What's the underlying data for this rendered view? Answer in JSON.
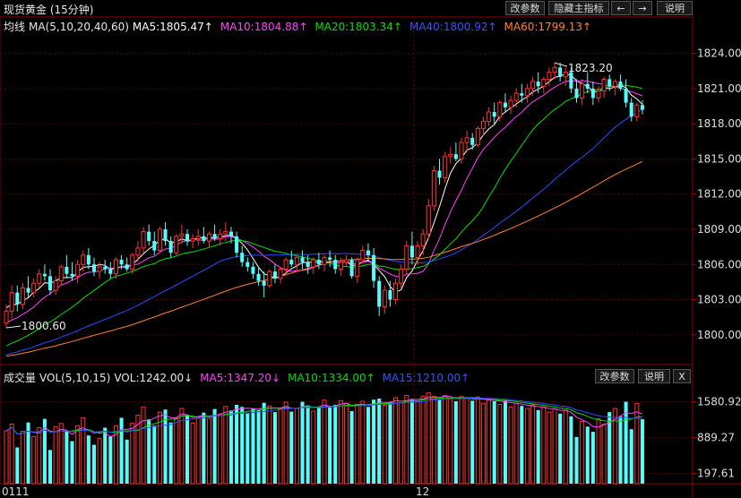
{
  "header": {
    "title": "现货黄金 (15分钟)",
    "buttons": [
      "改参数",
      "隐藏主指标",
      "←",
      "→",
      "说明"
    ]
  },
  "main_legend": {
    "label": "均线",
    "params": "MA(5,10,20,40,60)",
    "items": [
      {
        "text": "MA5:1805.47↑",
        "color": "#ffffff"
      },
      {
        "text": "MA10:1804.88↑",
        "color": "#ff40ff"
      },
      {
        "text": "MA20:1803.34↑",
        "color": "#00e000"
      },
      {
        "text": "MA40:1800.92↑",
        "color": "#2a4dff"
      },
      {
        "text": "MA60:1799.13↑",
        "color": "#ff8030"
      }
    ]
  },
  "vol_legend": {
    "label": "成交量",
    "params": "VOL(5,10,15)",
    "vol": "VOL:1242.00↓",
    "items": [
      {
        "text": "MA5:1347.20↓",
        "color": "#ff40ff"
      },
      {
        "text": "MA10:1334.00↑",
        "color": "#00e000"
      },
      {
        "text": "MA15:1210.00↑",
        "color": "#2a4dff"
      }
    ],
    "buttons": [
      "改参数",
      "说明",
      "X"
    ]
  },
  "annotations": {
    "low": "1800.60",
    "high": "1823.20"
  },
  "x_labels": [
    "0111",
    "12"
  ],
  "chart_data": [
    {
      "type": "candlestick",
      "title": "现货黄金 (15分钟)",
      "ylim": [
        1798.0,
        1825.5
      ],
      "y_ticks": [
        "1824.00",
        "1821.00",
        "1818.00",
        "1815.00",
        "1812.00",
        "1809.00",
        "1806.00",
        "1803.00",
        "1800.00"
      ],
      "ohlc": [
        [
          1801.0,
          1802.6,
          1800.6,
          1802.0
        ],
        [
          1802.0,
          1804.2,
          1801.4,
          1803.6
        ],
        [
          1803.6,
          1804.2,
          1802.0,
          1802.6
        ],
        [
          1802.6,
          1804.4,
          1802.2,
          1804.0
        ],
        [
          1804.0,
          1805.0,
          1803.2,
          1803.6
        ],
        [
          1803.6,
          1804.8,
          1803.2,
          1804.4
        ],
        [
          1804.4,
          1805.6,
          1804.0,
          1805.2
        ],
        [
          1805.2,
          1806.0,
          1804.6,
          1805.0
        ],
        [
          1805.0,
          1805.6,
          1803.4,
          1803.8
        ],
        [
          1803.8,
          1805.0,
          1803.4,
          1804.6
        ],
        [
          1804.6,
          1806.0,
          1804.2,
          1805.8
        ],
        [
          1805.8,
          1806.8,
          1804.8,
          1805.2
        ],
        [
          1805.2,
          1806.2,
          1804.6,
          1805.0
        ],
        [
          1805.0,
          1806.4,
          1804.4,
          1806.0
        ],
        [
          1806.0,
          1807.2,
          1805.4,
          1806.8
        ],
        [
          1806.8,
          1807.4,
          1805.6,
          1806.0
        ],
        [
          1806.0,
          1806.6,
          1805.0,
          1805.4
        ],
        [
          1805.4,
          1806.2,
          1804.8,
          1805.8
        ],
        [
          1805.8,
          1806.4,
          1805.2,
          1805.6
        ],
        [
          1805.6,
          1806.2,
          1804.8,
          1805.2
        ],
        [
          1805.2,
          1806.6,
          1804.8,
          1806.4
        ],
        [
          1806.4,
          1806.8,
          1805.6,
          1806.0
        ],
        [
          1806.0,
          1806.6,
          1805.4,
          1805.6
        ],
        [
          1805.6,
          1807.0,
          1805.2,
          1806.8
        ],
        [
          1806.8,
          1808.0,
          1806.2,
          1807.4
        ],
        [
          1807.4,
          1809.2,
          1807.0,
          1808.8
        ],
        [
          1808.8,
          1809.4,
          1807.6,
          1808.0
        ],
        [
          1808.0,
          1808.8,
          1806.8,
          1807.2
        ],
        [
          1807.2,
          1809.2,
          1807.0,
          1809.0
        ],
        [
          1809.0,
          1809.6,
          1807.6,
          1808.0
        ],
        [
          1808.0,
          1808.4,
          1806.6,
          1807.0
        ],
        [
          1807.0,
          1808.6,
          1806.8,
          1808.4
        ],
        [
          1808.4,
          1809.4,
          1807.8,
          1808.6
        ],
        [
          1808.6,
          1809.0,
          1807.6,
          1808.0
        ],
        [
          1808.0,
          1808.6,
          1807.4,
          1808.2
        ],
        [
          1808.2,
          1809.0,
          1807.6,
          1808.4
        ],
        [
          1808.4,
          1809.2,
          1807.8,
          1808.0
        ],
        [
          1808.0,
          1808.8,
          1807.4,
          1808.6
        ],
        [
          1808.6,
          1809.4,
          1808.0,
          1808.2
        ],
        [
          1808.2,
          1809.0,
          1807.6,
          1808.6
        ],
        [
          1808.6,
          1809.6,
          1808.0,
          1808.8
        ],
        [
          1808.8,
          1809.2,
          1807.8,
          1808.4
        ],
        [
          1808.4,
          1808.8,
          1806.6,
          1807.0
        ],
        [
          1807.0,
          1807.6,
          1805.8,
          1806.2
        ],
        [
          1806.2,
          1806.6,
          1805.4,
          1805.8
        ],
        [
          1805.8,
          1806.2,
          1804.8,
          1805.2
        ],
        [
          1805.2,
          1805.8,
          1804.2,
          1804.6
        ],
        [
          1804.6,
          1805.4,
          1803.2,
          1804.2
        ],
        [
          1804.2,
          1805.6,
          1804.0,
          1805.4
        ],
        [
          1805.4,
          1806.0,
          1804.4,
          1804.8
        ],
        [
          1804.8,
          1805.8,
          1804.4,
          1805.6
        ],
        [
          1805.6,
          1806.6,
          1805.0,
          1806.4
        ],
        [
          1806.4,
          1807.2,
          1805.8,
          1806.0
        ],
        [
          1806.0,
          1806.8,
          1805.4,
          1806.6
        ],
        [
          1806.6,
          1807.2,
          1805.6,
          1806.2
        ],
        [
          1806.2,
          1806.8,
          1805.2,
          1805.8
        ],
        [
          1805.8,
          1806.6,
          1805.2,
          1806.4
        ],
        [
          1806.4,
          1807.0,
          1805.6,
          1806.0
        ],
        [
          1806.0,
          1806.8,
          1805.4,
          1806.6
        ],
        [
          1806.6,
          1807.2,
          1805.8,
          1806.4
        ],
        [
          1806.4,
          1806.8,
          1805.2,
          1805.6
        ],
        [
          1805.6,
          1806.6,
          1805.0,
          1806.2
        ],
        [
          1806.2,
          1806.8,
          1805.8,
          1806.4
        ],
        [
          1806.4,
          1806.6,
          1804.8,
          1805.0
        ],
        [
          1805.0,
          1806.6,
          1804.4,
          1806.4
        ],
        [
          1806.4,
          1807.6,
          1806.0,
          1807.2
        ],
        [
          1807.2,
          1807.8,
          1806.4,
          1806.8
        ],
        [
          1806.8,
          1807.4,
          1804.0,
          1804.6
        ],
        [
          1804.6,
          1805.0,
          1801.6,
          1802.4
        ],
        [
          1802.4,
          1804.2,
          1801.8,
          1803.8
        ],
        [
          1803.8,
          1804.6,
          1802.4,
          1803.0
        ],
        [
          1803.0,
          1804.8,
          1802.6,
          1804.4
        ],
        [
          1804.4,
          1806.0,
          1804.0,
          1805.6
        ],
        [
          1805.6,
          1808.0,
          1805.2,
          1807.6
        ],
        [
          1807.6,
          1808.8,
          1806.0,
          1806.6
        ],
        [
          1806.6,
          1808.0,
          1806.0,
          1807.6
        ],
        [
          1807.6,
          1809.0,
          1806.8,
          1808.6
        ],
        [
          1808.6,
          1811.6,
          1808.2,
          1811.0
        ],
        [
          1811.0,
          1814.4,
          1810.6,
          1814.0
        ],
        [
          1814.0,
          1815.0,
          1812.8,
          1813.4
        ],
        [
          1813.4,
          1815.6,
          1813.0,
          1815.2
        ],
        [
          1815.2,
          1816.0,
          1814.6,
          1815.4
        ],
        [
          1815.4,
          1816.4,
          1814.8,
          1815.0
        ],
        [
          1815.0,
          1816.8,
          1814.6,
          1816.4
        ],
        [
          1816.4,
          1817.4,
          1815.6,
          1816.8
        ],
        [
          1816.8,
          1817.2,
          1815.8,
          1816.2
        ],
        [
          1816.2,
          1817.8,
          1816.0,
          1817.6
        ],
        [
          1817.6,
          1818.6,
          1817.0,
          1818.2
        ],
        [
          1818.2,
          1819.4,
          1817.8,
          1819.0
        ],
        [
          1819.0,
          1819.8,
          1818.0,
          1818.6
        ],
        [
          1818.6,
          1820.0,
          1818.2,
          1819.8
        ],
        [
          1819.8,
          1820.6,
          1819.0,
          1819.4
        ],
        [
          1819.4,
          1820.4,
          1818.8,
          1820.0
        ],
        [
          1820.0,
          1821.0,
          1819.4,
          1820.6
        ],
        [
          1820.6,
          1821.4,
          1819.8,
          1820.4
        ],
        [
          1820.4,
          1821.4,
          1819.8,
          1821.0
        ],
        [
          1821.0,
          1822.0,
          1820.4,
          1821.6
        ],
        [
          1821.6,
          1822.4,
          1820.6,
          1821.2
        ],
        [
          1821.2,
          1822.0,
          1820.6,
          1821.8
        ],
        [
          1821.8,
          1822.8,
          1821.2,
          1822.4
        ],
        [
          1822.4,
          1823.2,
          1821.8,
          1822.8
        ],
        [
          1822.8,
          1823.2,
          1821.6,
          1822.0
        ],
        [
          1822.0,
          1822.8,
          1821.2,
          1822.4
        ],
        [
          1822.4,
          1822.8,
          1820.6,
          1821.0
        ],
        [
          1821.0,
          1821.8,
          1819.8,
          1820.2
        ],
        [
          1820.2,
          1821.8,
          1819.6,
          1821.4
        ],
        [
          1821.4,
          1822.4,
          1820.6,
          1821.0
        ],
        [
          1821.0,
          1821.6,
          1819.6,
          1820.2
        ],
        [
          1820.2,
          1821.2,
          1819.8,
          1820.8
        ],
        [
          1820.8,
          1822.0,
          1820.2,
          1821.8
        ],
        [
          1821.8,
          1822.2,
          1820.8,
          1821.2
        ],
        [
          1821.2,
          1821.8,
          1820.4,
          1821.6
        ],
        [
          1821.6,
          1822.2,
          1820.8,
          1821.0
        ],
        [
          1821.0,
          1821.8,
          1819.4,
          1819.8
        ],
        [
          1819.8,
          1820.2,
          1818.2,
          1818.6
        ],
        [
          1818.6,
          1819.8,
          1818.2,
          1819.6
        ],
        [
          1819.6,
          1820.0,
          1818.8,
          1819.2
        ]
      ]
    },
    {
      "type": "bar",
      "title": "成交量",
      "ylim": [
        0,
        1900
      ],
      "y_ticks": [
        "1580.92",
        "889.27",
        "197.61"
      ],
      "values": [
        1020,
        1150,
        700,
        1010,
        1180,
        910,
        1080,
        1250,
        650,
        1100,
        1160,
        1010,
        820,
        1120,
        1270,
        930,
        750,
        870,
        1080,
        910,
        1120,
        1270,
        850,
        1170,
        1320,
        1480,
        1240,
        1120,
        1380,
        1430,
        1180,
        1260,
        1450,
        1320,
        1170,
        1280,
        1370,
        1260,
        1440,
        1340,
        1490,
        1410,
        1520,
        1480,
        1370,
        1450,
        1420,
        1560,
        1500,
        1380,
        1440,
        1570,
        1390,
        1450,
        1580,
        1510,
        1400,
        1480,
        1610,
        1470,
        1520,
        1600,
        1550,
        1400,
        1530,
        1590,
        1480,
        1620,
        1640,
        1510,
        1580,
        1660,
        1560,
        1700,
        1630,
        1580,
        1690,
        1750,
        1680,
        1620,
        1700,
        1650,
        1590,
        1680,
        1640,
        1600,
        1670,
        1550,
        1620,
        1590,
        1530,
        1600,
        1480,
        1550,
        1500,
        1450,
        1520,
        1420,
        1480,
        1380,
        1440,
        1350,
        1420,
        1300,
        900,
        1200,
        1100,
        1000,
        1250,
        1150,
        1380,
        1450,
        1300,
        1580,
        1050,
        1550,
        1242
      ],
      "ma_lines": [
        "MA5",
        "MA10",
        "MA15"
      ]
    }
  ]
}
